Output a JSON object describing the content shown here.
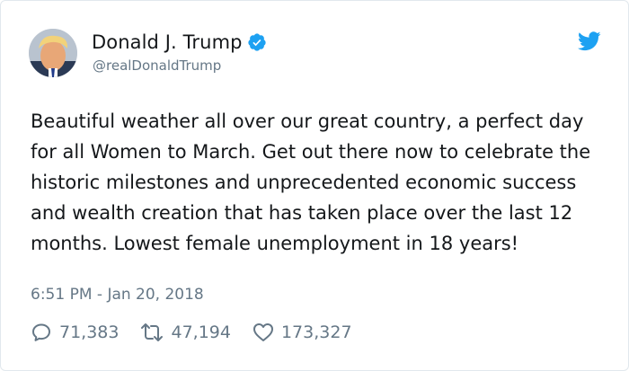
{
  "author": {
    "name": "Donald J. Trump",
    "handle": "@realDonaldTrump"
  },
  "tweet": {
    "text": "Beautiful weather all over our great country, a perfect day for all Women to March. Get out there now to celebrate the historic milestones and unprecedented economic success and wealth creation that has taken place over the last 12 months. Lowest female unemployment in 18 years!",
    "timestamp": "6:51 PM - Jan 20, 2018"
  },
  "stats": {
    "replies": "71,383",
    "retweets": "47,194",
    "likes": "173,327"
  },
  "icons": {
    "verified": "verified-badge-icon",
    "brand": "twitter-bird-icon",
    "reply": "reply-icon",
    "retweet": "retweet-icon",
    "like": "heart-icon"
  },
  "colors": {
    "brand": "#1da1f2",
    "text": "#14171a",
    "muted": "#657786"
  }
}
